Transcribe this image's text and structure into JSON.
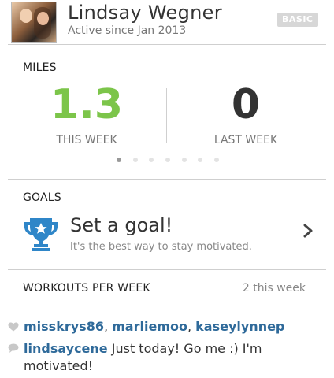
{
  "profile": {
    "name": "Lindsay Wegner",
    "active_since": "Active since Jan 2013",
    "badge": "BASIC"
  },
  "miles": {
    "title": "MILES",
    "this_week_value": "1.3",
    "this_week_label": "THIS WEEK",
    "last_week_value": "0",
    "last_week_label": "LAST WEEK",
    "page_count": 7,
    "active_page": 1,
    "this_week_color": "#7cc54a"
  },
  "goals": {
    "title": "GOALS",
    "cta_title": "Set a goal!",
    "cta_subtitle": "It's the best way to stay motivated.",
    "icon": "trophy-icon",
    "icon_color": "#2f86c8"
  },
  "workouts": {
    "title": "WORKOUTS PER WEEK",
    "summary": "2 this week"
  },
  "activity": {
    "likes": {
      "icon": "heart-icon",
      "users": [
        "misskrys86",
        "marliemoo",
        "kaseylynnep"
      ],
      "separator": ", "
    },
    "comment": {
      "icon": "comment-icon",
      "user": "lindsaycene",
      "text": " Just today! Go me :) I'm motivated!"
    }
  },
  "colors": {
    "link": "#2f6a9a",
    "divider": "#cfcfcf"
  }
}
